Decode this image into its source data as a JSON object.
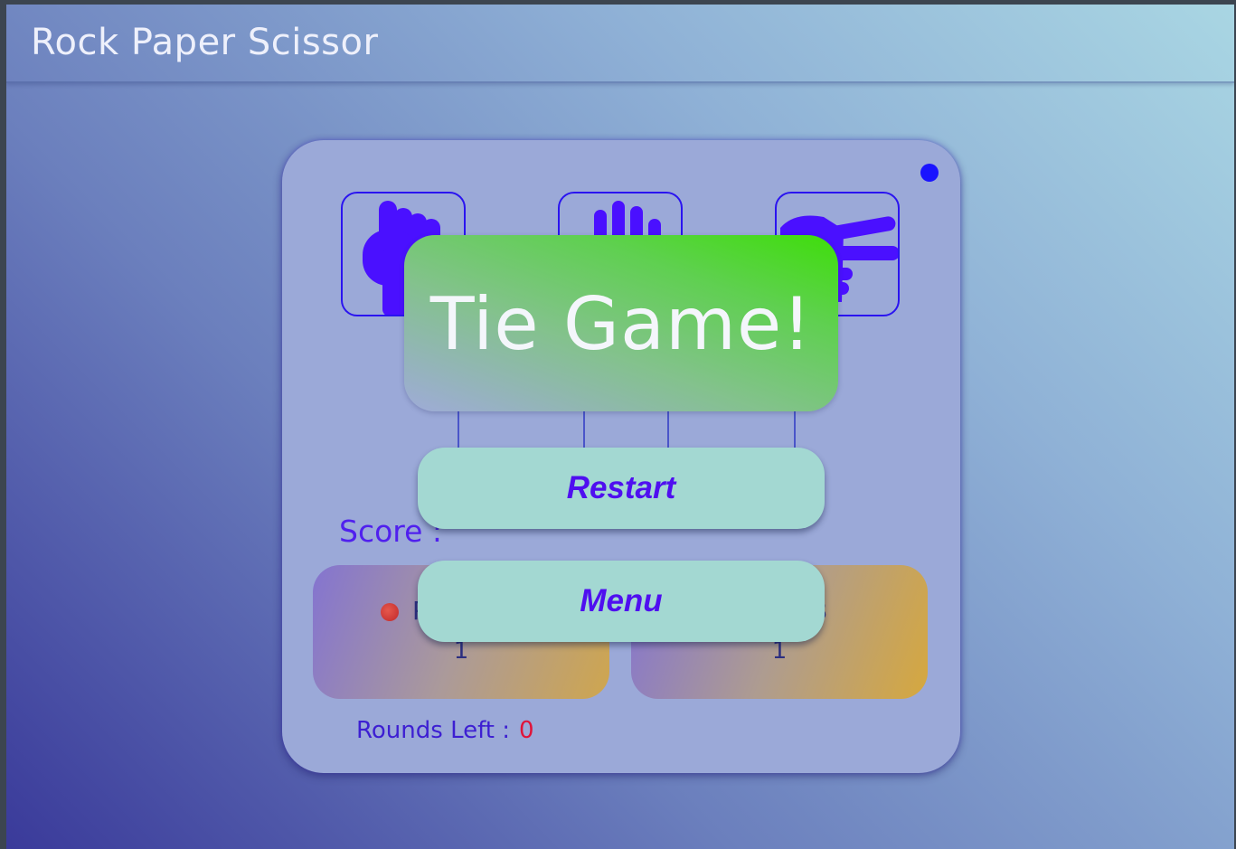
{
  "app": {
    "title": "Rock Paper Scissor"
  },
  "choices": [
    {
      "name": "rock",
      "icon": "rock-hand-icon"
    },
    {
      "name": "paper",
      "icon": "paper-hand-icon"
    },
    {
      "name": "scissor",
      "icon": "scissor-hand-icon"
    }
  ],
  "score": {
    "label": "Score :",
    "players": [
      {
        "name_visible": "P",
        "score": "1"
      },
      {
        "name_visible": "B",
        "score": "1"
      }
    ]
  },
  "rounds": {
    "label": "Rounds Left :",
    "value": "0"
  },
  "result": {
    "text": "Tie Game!"
  },
  "actions": {
    "restart_label": "Restart",
    "menu_label": "Menu"
  },
  "colors": {
    "accent": "#4f0ff0",
    "icon": "#4a10ff",
    "rounds_value": "#e0143a",
    "status_dot": "#1a14ff"
  }
}
